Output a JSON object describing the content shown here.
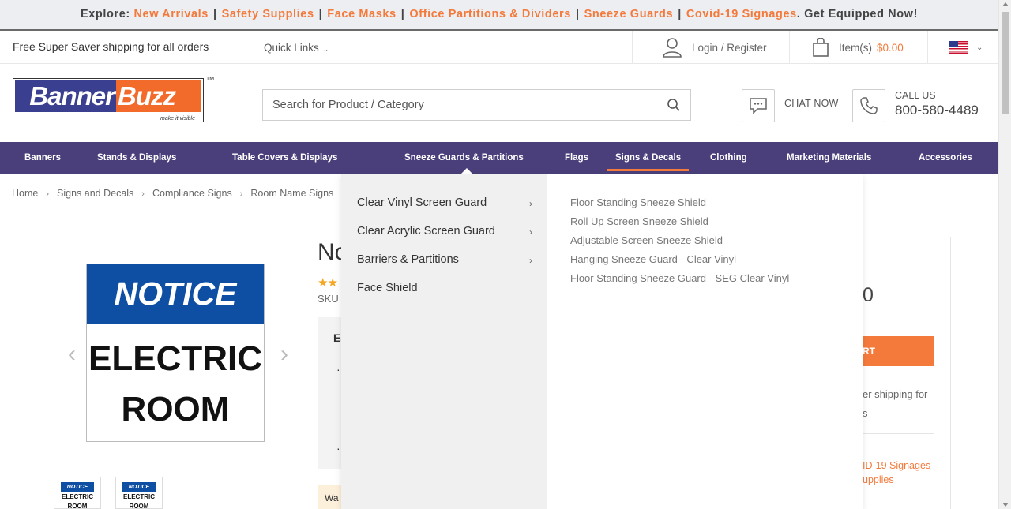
{
  "promo": {
    "explore_label": "Explore:",
    "links": [
      "New Arrivals",
      "Safety Supplies",
      "Face Masks",
      "Office Partitions & Dividers",
      "Sneeze Guards",
      "Covid-19 Signages"
    ],
    "separator": "|",
    "period": ".",
    "cta": "Get Equipped Now!"
  },
  "utility": {
    "shipping_text": "Free Super Saver shipping for all orders",
    "quick_links": "Quick Links",
    "login": "Login / Register",
    "cart_label": "Item(s)",
    "cart_amount": "$0.00",
    "region_icon": "us-flag-icon"
  },
  "header": {
    "logo_part1": "Banner",
    "logo_part2": "Buzz",
    "logo_tagline": "make it visible",
    "logo_tm": "TM",
    "search_placeholder": "Search for Product / Category",
    "chat_label": "CHAT NOW",
    "call_label": "CALL US",
    "phone": "800-580-4489"
  },
  "nav": {
    "items": [
      "Banners",
      "Stands & Displays",
      "Table Covers & Displays",
      "Sneeze Guards & Partitions",
      "Flags",
      "Signs & Decals",
      "Clothing",
      "Marketing Materials",
      "Accessories"
    ],
    "active": "Signs & Decals",
    "hovered": "Sneeze Guards & Partitions"
  },
  "breadcrumb": [
    "Home",
    "Signs and Decals",
    "Compliance Signs",
    "Room Name Signs"
  ],
  "mega_menu": {
    "categories": [
      "Clear Vinyl Screen Guard",
      "Clear Acrylic Screen Guard",
      "Barriers & Partitions",
      "Face Shield"
    ],
    "subitems": [
      "Floor Standing Sneeze Shield",
      "Roll Up Screen Sneeze Shield",
      "Adjustable Screen Sneeze Shield",
      "Hanging Sneeze Guard - Clear Vinyl",
      "Floor Standing Sneeze Guard - SEG Clear Vinyl"
    ]
  },
  "product": {
    "sign_header": "NOTICE",
    "sign_line1": "ELECTRIC",
    "sign_line2": "ROOM",
    "title_fragment": "No",
    "stars": "★★",
    "sku_fragment": "SKU :",
    "box_title_fragment": "Ea",
    "bullet": "·",
    "warn_fragment": "Wa",
    "price_fragment": "0",
    "cta_fragment": "RT",
    "shipping_fragment_1": "er shipping for",
    "shipping_fragment_2": "s",
    "link_fragment_1": "ID-19 Signages",
    "link_fragment_2": "upplies"
  },
  "colors": {
    "brand_purple": "#4a3f7a",
    "accent_orange": "#f47a3c",
    "notice_blue": "#0e4fa3"
  }
}
